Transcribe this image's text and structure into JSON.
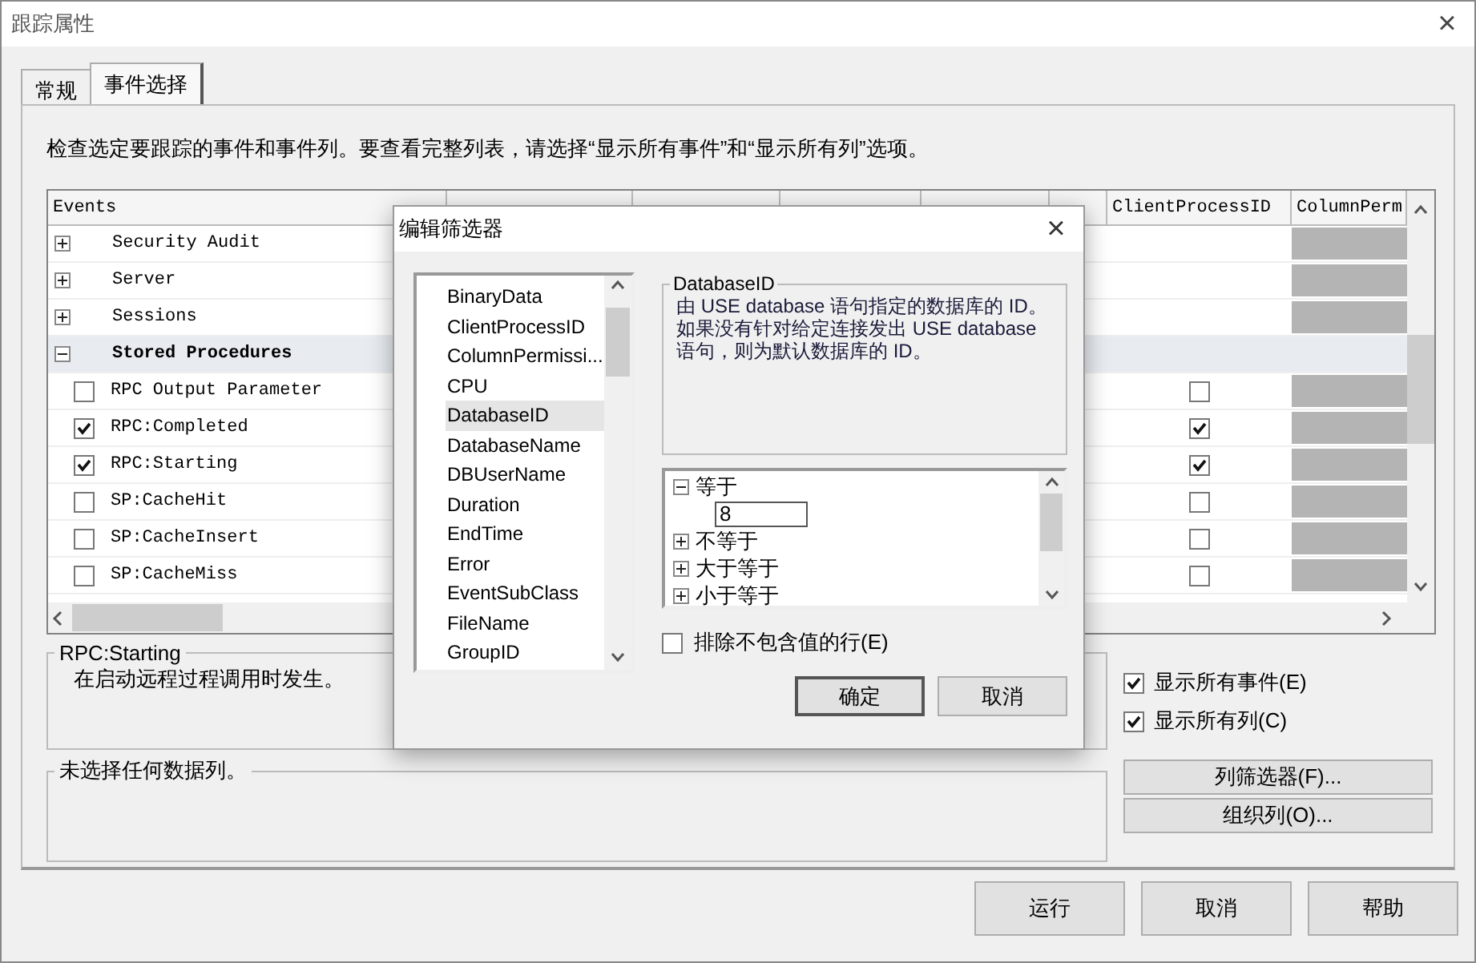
{
  "window": {
    "title": "跟踪属性",
    "close": "×"
  },
  "tabs": [
    {
      "label": "常规",
      "selected": false
    },
    {
      "label": "事件选择",
      "selected": true
    }
  ],
  "instructions": "检查选定要跟踪的事件和事件列。要查看完整列表，请选择“显示所有事件”和“显示所有列”选项。",
  "events_grid": {
    "columns": [
      "Events",
      "ClientProcessID",
      "ColumnPerm"
    ],
    "rows": [
      {
        "kind": "category",
        "label": "Security Audit",
        "expanded": false,
        "selected": false,
        "column_perm_disabled": true
      },
      {
        "kind": "category",
        "label": "Server",
        "expanded": false,
        "selected": false,
        "column_perm_disabled": true
      },
      {
        "kind": "category",
        "label": "Sessions",
        "expanded": false,
        "selected": false,
        "column_perm_disabled": true
      },
      {
        "kind": "category",
        "label": "Stored Procedures",
        "expanded": true,
        "selected": true,
        "column_perm_disabled": false
      },
      {
        "kind": "event",
        "label": "RPC Output Parameter",
        "checked": false,
        "client_process_id_checked": false,
        "column_perm_disabled": true
      },
      {
        "kind": "event",
        "label": "RPC:Completed",
        "checked": true,
        "client_process_id_checked": true,
        "column_perm_disabled": true
      },
      {
        "kind": "event",
        "label": "RPC:Starting",
        "checked": true,
        "client_process_id_checked": true,
        "column_perm_disabled": true
      },
      {
        "kind": "event",
        "label": "SP:CacheHit",
        "checked": false,
        "client_process_id_checked": false,
        "column_perm_disabled": true
      },
      {
        "kind": "event",
        "label": "SP:CacheInsert",
        "checked": false,
        "client_process_id_checked": false,
        "column_perm_disabled": true
      },
      {
        "kind": "event",
        "label": "SP:CacheMiss",
        "checked": false,
        "client_process_id_checked": false,
        "column_perm_disabled": true
      }
    ]
  },
  "event_description": {
    "title": "RPC:Starting",
    "text": "在启动远程过程调用时发生。"
  },
  "show_options": [
    {
      "label": "显示所有事件(E)",
      "checked": true
    },
    {
      "label": "显示所有列(C)",
      "checked": true
    }
  ],
  "column_description": {
    "title": "未选择任何数据列。"
  },
  "side_buttons": [
    "列筛选器(F)...",
    "组织列(O)..."
  ],
  "footer_buttons": [
    "运行",
    "取消",
    "帮助"
  ],
  "filter_dialog": {
    "title": "编辑筛选器",
    "close": "×",
    "columns": [
      {
        "label": "BinaryData",
        "selected": false
      },
      {
        "label": "ClientProcessID",
        "selected": false
      },
      {
        "label": "ColumnPermissi...",
        "selected": false
      },
      {
        "label": "CPU",
        "selected": false
      },
      {
        "label": "DatabaseID",
        "selected": true
      },
      {
        "label": "DatabaseName",
        "selected": false
      },
      {
        "label": "DBUserName",
        "selected": false
      },
      {
        "label": "Duration",
        "selected": false
      },
      {
        "label": "EndTime",
        "selected": false
      },
      {
        "label": "Error",
        "selected": false
      },
      {
        "label": "EventSubClass",
        "selected": false
      },
      {
        "label": "FileName",
        "selected": false
      },
      {
        "label": "GroupID",
        "selected": false
      }
    ],
    "description": {
      "title": "DatabaseID",
      "text": "由 USE database 语句指定的数据库的 ID。如果没有针对给定连接发出 USE database 语句，则为默认数据库的 ID。"
    },
    "conditions": [
      {
        "label": "等于",
        "expanded": true,
        "children": [
          {
            "value": "8"
          }
        ]
      },
      {
        "label": "不等于",
        "expanded": false
      },
      {
        "label": "大于等于",
        "expanded": false
      },
      {
        "label": "小于等于",
        "expanded": false
      }
    ],
    "exclude_empty": {
      "label": "排除不包含值的行(E)",
      "checked": false
    },
    "buttons": [
      {
        "label": "确定",
        "default": true
      },
      {
        "label": "取消",
        "default": false
      }
    ]
  }
}
